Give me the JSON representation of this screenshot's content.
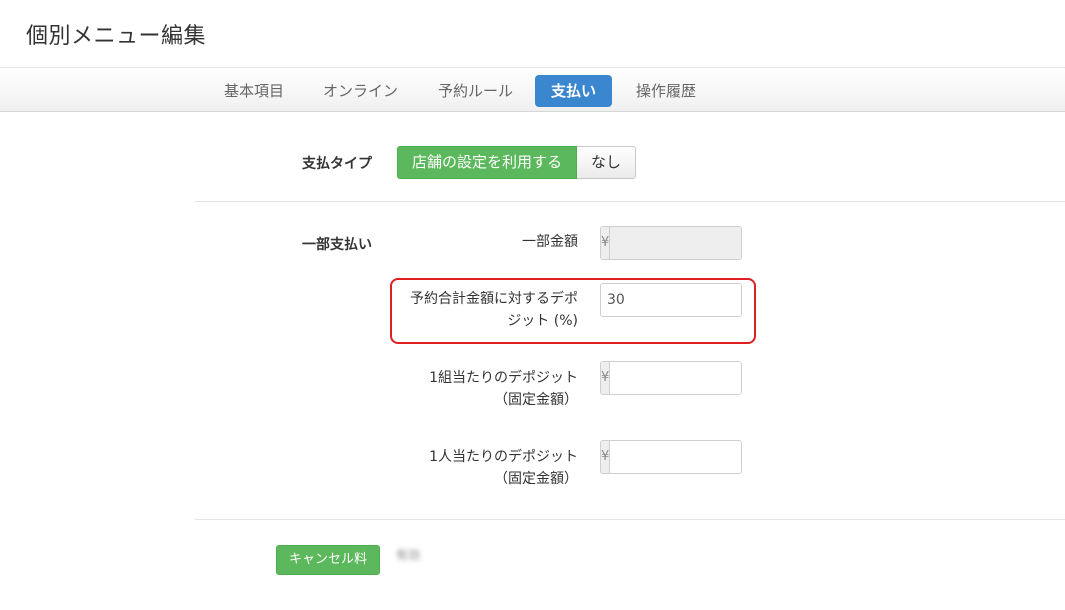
{
  "page": {
    "title": "個別メニュー編集"
  },
  "tabs": [
    {
      "label": "基本項目"
    },
    {
      "label": "オンライン"
    },
    {
      "label": "予約ルール"
    },
    {
      "label": "支払い",
      "active": true
    },
    {
      "label": "操作履歴"
    }
  ],
  "payment_type": {
    "label": "支払タイプ",
    "options": [
      {
        "label": "店舗の設定を利用する",
        "selected": true
      },
      {
        "label": "なし",
        "selected": false
      }
    ]
  },
  "partial_payment": {
    "label": "一部支払い",
    "fields": [
      {
        "label_line1": "一部金額",
        "label_line2": "",
        "prefix": "¥",
        "suffix": "",
        "value": "",
        "disabled": true
      },
      {
        "label_line1": "予約合計金額に対するデポ",
        "label_line2": "ジット (%)",
        "prefix": "",
        "suffix": "%",
        "value": "30",
        "disabled": false
      },
      {
        "label_line1": "1組当たりのデポジット",
        "label_line2": "（固定金額）",
        "prefix": "¥",
        "suffix": "",
        "value": "",
        "disabled": false
      },
      {
        "label_line1": "1人当たりのデポジット",
        "label_line2": "（固定金額）",
        "prefix": "¥",
        "suffix": "",
        "value": "",
        "disabled": false
      }
    ]
  },
  "cancel_fee": {
    "button_label": "キャンセル料",
    "blurred_text": "有効"
  },
  "colors": {
    "accent_blue": "#3a87cf",
    "green": "#5cb85c",
    "highlight_red": "#e02020"
  }
}
